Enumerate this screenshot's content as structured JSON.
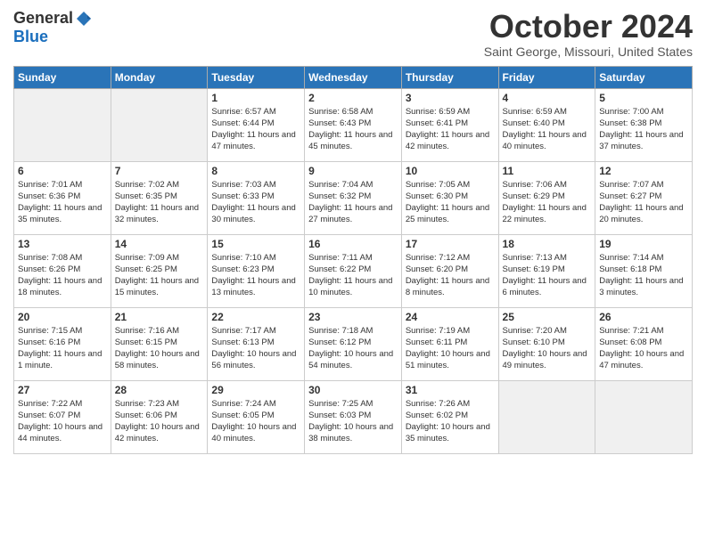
{
  "header": {
    "logo_general": "General",
    "logo_blue": "Blue",
    "month_title": "October 2024",
    "location": "Saint George, Missouri, United States"
  },
  "days_of_week": [
    "Sunday",
    "Monday",
    "Tuesday",
    "Wednesday",
    "Thursday",
    "Friday",
    "Saturday"
  ],
  "weeks": [
    [
      {
        "day": "",
        "info": ""
      },
      {
        "day": "",
        "info": ""
      },
      {
        "day": "1",
        "info": "Sunrise: 6:57 AM\nSunset: 6:44 PM\nDaylight: 11 hours and 47 minutes."
      },
      {
        "day": "2",
        "info": "Sunrise: 6:58 AM\nSunset: 6:43 PM\nDaylight: 11 hours and 45 minutes."
      },
      {
        "day": "3",
        "info": "Sunrise: 6:59 AM\nSunset: 6:41 PM\nDaylight: 11 hours and 42 minutes."
      },
      {
        "day": "4",
        "info": "Sunrise: 6:59 AM\nSunset: 6:40 PM\nDaylight: 11 hours and 40 minutes."
      },
      {
        "day": "5",
        "info": "Sunrise: 7:00 AM\nSunset: 6:38 PM\nDaylight: 11 hours and 37 minutes."
      }
    ],
    [
      {
        "day": "6",
        "info": "Sunrise: 7:01 AM\nSunset: 6:36 PM\nDaylight: 11 hours and 35 minutes."
      },
      {
        "day": "7",
        "info": "Sunrise: 7:02 AM\nSunset: 6:35 PM\nDaylight: 11 hours and 32 minutes."
      },
      {
        "day": "8",
        "info": "Sunrise: 7:03 AM\nSunset: 6:33 PM\nDaylight: 11 hours and 30 minutes."
      },
      {
        "day": "9",
        "info": "Sunrise: 7:04 AM\nSunset: 6:32 PM\nDaylight: 11 hours and 27 minutes."
      },
      {
        "day": "10",
        "info": "Sunrise: 7:05 AM\nSunset: 6:30 PM\nDaylight: 11 hours and 25 minutes."
      },
      {
        "day": "11",
        "info": "Sunrise: 7:06 AM\nSunset: 6:29 PM\nDaylight: 11 hours and 22 minutes."
      },
      {
        "day": "12",
        "info": "Sunrise: 7:07 AM\nSunset: 6:27 PM\nDaylight: 11 hours and 20 minutes."
      }
    ],
    [
      {
        "day": "13",
        "info": "Sunrise: 7:08 AM\nSunset: 6:26 PM\nDaylight: 11 hours and 18 minutes."
      },
      {
        "day": "14",
        "info": "Sunrise: 7:09 AM\nSunset: 6:25 PM\nDaylight: 11 hours and 15 minutes."
      },
      {
        "day": "15",
        "info": "Sunrise: 7:10 AM\nSunset: 6:23 PM\nDaylight: 11 hours and 13 minutes."
      },
      {
        "day": "16",
        "info": "Sunrise: 7:11 AM\nSunset: 6:22 PM\nDaylight: 11 hours and 10 minutes."
      },
      {
        "day": "17",
        "info": "Sunrise: 7:12 AM\nSunset: 6:20 PM\nDaylight: 11 hours and 8 minutes."
      },
      {
        "day": "18",
        "info": "Sunrise: 7:13 AM\nSunset: 6:19 PM\nDaylight: 11 hours and 6 minutes."
      },
      {
        "day": "19",
        "info": "Sunrise: 7:14 AM\nSunset: 6:18 PM\nDaylight: 11 hours and 3 minutes."
      }
    ],
    [
      {
        "day": "20",
        "info": "Sunrise: 7:15 AM\nSunset: 6:16 PM\nDaylight: 11 hours and 1 minute."
      },
      {
        "day": "21",
        "info": "Sunrise: 7:16 AM\nSunset: 6:15 PM\nDaylight: 10 hours and 58 minutes."
      },
      {
        "day": "22",
        "info": "Sunrise: 7:17 AM\nSunset: 6:13 PM\nDaylight: 10 hours and 56 minutes."
      },
      {
        "day": "23",
        "info": "Sunrise: 7:18 AM\nSunset: 6:12 PM\nDaylight: 10 hours and 54 minutes."
      },
      {
        "day": "24",
        "info": "Sunrise: 7:19 AM\nSunset: 6:11 PM\nDaylight: 10 hours and 51 minutes."
      },
      {
        "day": "25",
        "info": "Sunrise: 7:20 AM\nSunset: 6:10 PM\nDaylight: 10 hours and 49 minutes."
      },
      {
        "day": "26",
        "info": "Sunrise: 7:21 AM\nSunset: 6:08 PM\nDaylight: 10 hours and 47 minutes."
      }
    ],
    [
      {
        "day": "27",
        "info": "Sunrise: 7:22 AM\nSunset: 6:07 PM\nDaylight: 10 hours and 44 minutes."
      },
      {
        "day": "28",
        "info": "Sunrise: 7:23 AM\nSunset: 6:06 PM\nDaylight: 10 hours and 42 minutes."
      },
      {
        "day": "29",
        "info": "Sunrise: 7:24 AM\nSunset: 6:05 PM\nDaylight: 10 hours and 40 minutes."
      },
      {
        "day": "30",
        "info": "Sunrise: 7:25 AM\nSunset: 6:03 PM\nDaylight: 10 hours and 38 minutes."
      },
      {
        "day": "31",
        "info": "Sunrise: 7:26 AM\nSunset: 6:02 PM\nDaylight: 10 hours and 35 minutes."
      },
      {
        "day": "",
        "info": ""
      },
      {
        "day": "",
        "info": ""
      }
    ]
  ]
}
